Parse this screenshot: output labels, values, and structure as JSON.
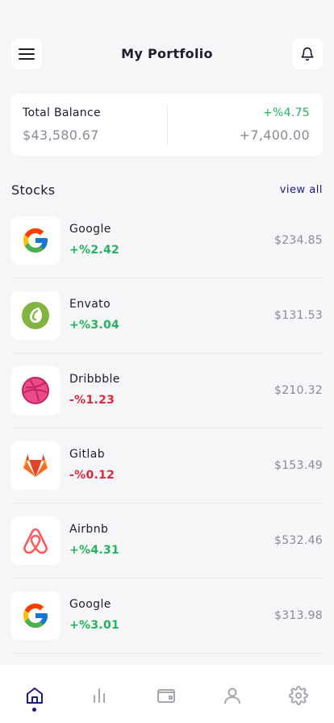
{
  "header": {
    "title": "My Portfolio",
    "menu_icon": "hamburger-menu-icon",
    "notification_icon": "bell-icon"
  },
  "balance": {
    "label": "Total Balance",
    "value": "$43,580.67",
    "change": "+%4.75",
    "change_amount": "+7,400.00"
  },
  "stocks_section": {
    "title": "Stocks",
    "view_all": "view all"
  },
  "stocks": [
    {
      "name": "Google",
      "change": "+%2.42",
      "price": "$234.85",
      "trend": "up",
      "icon": "google-logo-icon"
    },
    {
      "name": "Envato",
      "change": "+%3.04",
      "price": "$131.53",
      "trend": "up",
      "icon": "envato-logo-icon"
    },
    {
      "name": "Dribbble",
      "change": "-%1.23",
      "price": "$210.32",
      "trend": "down",
      "icon": "dribbble-logo-icon"
    },
    {
      "name": "Gitlab",
      "change": "-%0.12",
      "price": "$153.49",
      "trend": "down",
      "icon": "gitlab-logo-icon"
    },
    {
      "name": "Airbnb",
      "change": "+%4.31",
      "price": "$532.46",
      "trend": "up",
      "icon": "airbnb-logo-icon"
    },
    {
      "name": "Google",
      "change": "+%3.01",
      "price": "$313.98",
      "trend": "up",
      "icon": "google-logo-icon"
    }
  ],
  "bottom_nav": [
    {
      "icon": "home-icon",
      "active": true
    },
    {
      "icon": "bar-chart-icon",
      "active": false
    },
    {
      "icon": "wallet-icon",
      "active": false
    },
    {
      "icon": "user-icon",
      "active": false
    },
    {
      "icon": "settings-gear-icon",
      "active": false
    }
  ],
  "colors": {
    "positive": "#24b35c",
    "negative": "#d6293e",
    "accent": "#1a1a80",
    "background": "#f6f6f8"
  }
}
